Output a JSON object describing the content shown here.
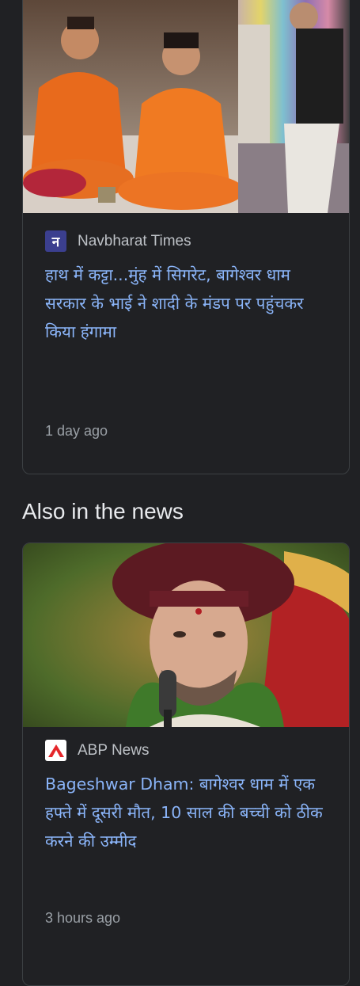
{
  "top_story": {
    "source": "Navbharat Times",
    "source_logo_letter": "न",
    "headline": "हाथ में कट्टा...मुंह में सिगरेट, बागेश्वर धाम सरकार के भाई ने शादी के मंडप पर पहुंचकर किया हंगामा",
    "time": "1 day ago",
    "image_icon": "photo-collage-icon"
  },
  "also_in_news": {
    "title": "Also in the news",
    "items": [
      {
        "source": "ABP News",
        "headline": "Bageshwar Dham: बागेश्वर धाम में एक हफ्ते में दूसरी मौत, 10 साल की बच्ची को ठीक करने की उम्मीद",
        "time": "3 hours ago",
        "image_icon": "portrait-photo-icon"
      }
    ]
  },
  "colors": {
    "background": "#202124",
    "card_border": "#3c4043",
    "headline": "#8ab4f8",
    "source_text": "#bdc1c6",
    "meta_text": "#9aa0a6",
    "nbt_logo_bg": "#3b3f8f",
    "abp_logo_red": "#e5262a"
  }
}
